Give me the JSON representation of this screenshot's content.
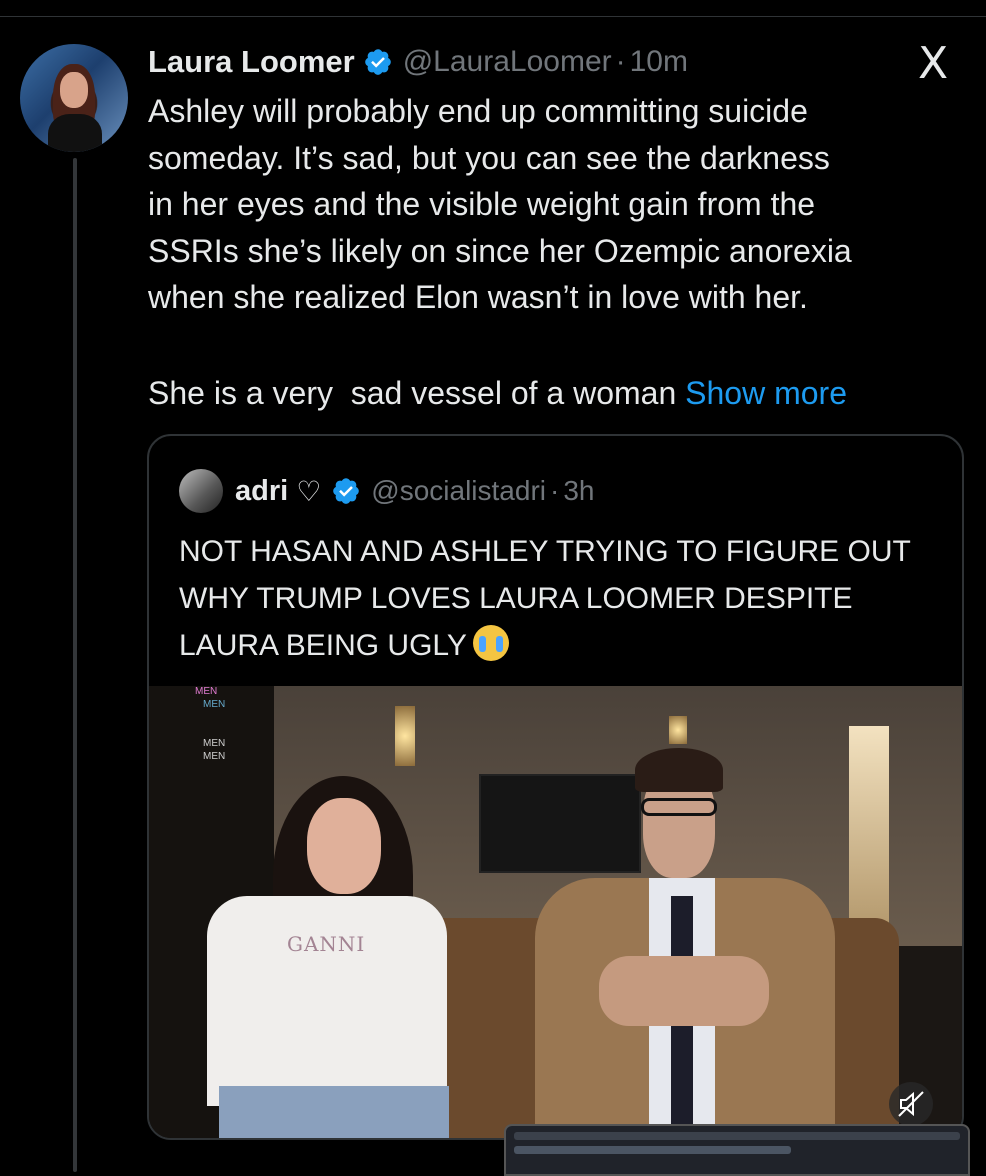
{
  "tweet": {
    "author_name": "Laura Loomer",
    "handle": "@LauraLoomer",
    "separator": "·",
    "time": "10m",
    "body_lines": [
      "Ashley will probably end up committing suicide",
      "someday. It’s sad, but you can see the darkness",
      "in her eyes and the visible weight gain from the",
      "SSRIs she’s likely on since her Ozempic anorexia",
      "when she realized Elon wasn’t in love with her."
    ],
    "last_line": "She is a very  sad vessel of a woman ",
    "show_more": "Show more"
  },
  "quote": {
    "author_name": "adri",
    "heart": "♡",
    "handle": "@socialistadri",
    "separator": "·",
    "time": "3h",
    "text": "NOT HASAN AND ASHLEY TRYING TO FIGURE OUT WHY TRUMP LOVES LAURA LOOMER DESPITE LAURA BEING UGLY",
    "emoji_icon": "crying-face-emoji"
  },
  "video": {
    "chat": [
      "MEN",
      "MEN",
      "",
      "",
      "MEN",
      "MEN"
    ],
    "shirt_text": "GANNI"
  },
  "icons": {
    "verified": "verified-badge-icon",
    "x_logo": "X",
    "mute": "mute-icon"
  },
  "colors": {
    "background": "#000000",
    "text": "#e7e9ea",
    "muted": "#71767b",
    "link": "#1d9bf0",
    "border": "#2f3336",
    "verified": "#1d9bf0"
  }
}
